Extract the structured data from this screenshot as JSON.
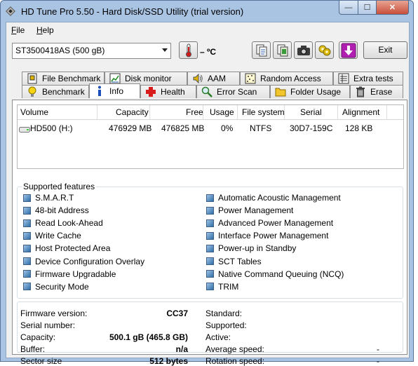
{
  "window": {
    "title": "HD Tune Pro 5.50 - Hard Disk/SSD Utility (trial version)",
    "min_glyph": "—",
    "max_glyph": "☐",
    "close_glyph": "✕"
  },
  "menu": {
    "items": [
      {
        "label": "File",
        "mnemonic": "F"
      },
      {
        "label": "Help",
        "mnemonic": "H"
      }
    ]
  },
  "toolbar": {
    "drive_selected": "ST3500418AS (500 gB)",
    "temperature": "– ºC",
    "exit_label": "Exit",
    "icons": [
      "copy-text-icon",
      "copy-screenshot-icon",
      "camera-icon",
      "options-icon",
      "save-down-icon"
    ]
  },
  "tabs": {
    "row1": [
      {
        "label": "File Benchmark",
        "icon": "file-benchmark-icon"
      },
      {
        "label": "Disk monitor",
        "icon": "disk-monitor-icon"
      },
      {
        "label": "AAM",
        "icon": "speaker-icon"
      },
      {
        "label": "Random Access",
        "icon": "random-access-icon"
      },
      {
        "label": "Extra tests",
        "icon": "extra-tests-icon"
      }
    ],
    "row2": [
      {
        "label": "Benchmark",
        "icon": "lightbulb-icon"
      },
      {
        "label": "Info",
        "icon": "info-icon"
      },
      {
        "label": "Health",
        "icon": "health-cross-icon"
      },
      {
        "label": "Error Scan",
        "icon": "magnifier-icon"
      },
      {
        "label": "Folder Usage",
        "icon": "folder-icon"
      },
      {
        "label": "Erase",
        "icon": "trash-icon"
      }
    ],
    "active": "Info"
  },
  "volumes": {
    "headers": [
      "Volume",
      "Capacity",
      "Free",
      "Usage",
      "File system",
      "Serial",
      "Alignment"
    ],
    "rows": [
      {
        "volume": "HD500 (H:)",
        "capacity": "476929 MB",
        "free": "476825 MB",
        "usage": "0%",
        "file_system": "NTFS",
        "serial": "30D7-159C",
        "alignment": "128 KB"
      }
    ]
  },
  "features": {
    "title": "Supported features",
    "left": [
      "S.M.A.R.T",
      "48-bit Address",
      "Read Look-Ahead",
      "Write Cache",
      "Host Protected Area",
      "Device Configuration Overlay",
      "Firmware Upgradable",
      "Security Mode"
    ],
    "right": [
      "Automatic Acoustic Management",
      "Power Management",
      "Advanced Power Management",
      "Interface Power Management",
      "Power-up in Standby",
      "SCT Tables",
      "Native Command Queuing (NCQ)",
      "TRIM"
    ]
  },
  "info": {
    "left": [
      {
        "label": "Firmware version:",
        "value": "CC37"
      },
      {
        "label": "Serial number:",
        "value": ""
      },
      {
        "label": "Capacity:",
        "value": "500.1 gB (465.8 GB)"
      },
      {
        "label": "Buffer:",
        "value": "n/a"
      },
      {
        "label": "Sector size",
        "value": "512 bytes"
      }
    ],
    "right": [
      {
        "label": "Standard:",
        "value": ""
      },
      {
        "label": "Supported:",
        "value": ""
      },
      {
        "label": "Active:",
        "value": ""
      },
      {
        "label": "Average speed:",
        "value": "-"
      },
      {
        "label": "Rotation speed:",
        "value": "-"
      }
    ]
  }
}
